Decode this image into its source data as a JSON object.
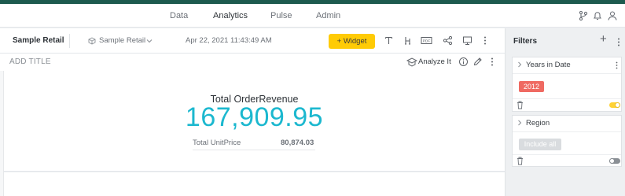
{
  "nav": {
    "tabs": [
      {
        "label": "Data",
        "active": false
      },
      {
        "label": "Analytics",
        "active": true
      },
      {
        "label": "Pulse",
        "active": false
      },
      {
        "label": "Admin",
        "active": false
      }
    ],
    "icons": [
      "git-branch-icon",
      "bell-icon",
      "user-icon"
    ]
  },
  "toolbar": {
    "dashboard_title": "Sample Retail",
    "datasource": "Sample Retail",
    "timestamp": "Apr 22, 2021 11:43:49 AM",
    "widget_button": "Widget",
    "widget_button_prefix": "+",
    "icons": [
      "text-icon",
      "filter-icon",
      "pdf-icon",
      "share-icon",
      "present-icon",
      "more-icon"
    ]
  },
  "subbar": {
    "add_title": "ADD TITLE",
    "analyze_label": "Analyze It"
  },
  "widget": {
    "kpi_title": "Total OrderRevenue",
    "kpi_value": "167,909.95",
    "secondary_label": "Total UnitPrice",
    "secondary_value": "80,874.03",
    "value_color": "#1cb8cf"
  },
  "filters": {
    "title": "Filters",
    "add_symbol": "+",
    "cards": [
      {
        "name": "Years in Date",
        "chip": "2012",
        "chip_color": "#ef6a62",
        "toggle_on": true,
        "toggle_color": "#ffd234"
      },
      {
        "name": "Region",
        "chip": "Include all",
        "chip_color": "#d9dcdf",
        "toggle_on": false,
        "toggle_color": "#8a8f95"
      }
    ]
  },
  "colors": {
    "accent_bar": "#1d5a4e",
    "active_tab_underline": "#00a6c7",
    "widget_button": "#ffcb05"
  }
}
